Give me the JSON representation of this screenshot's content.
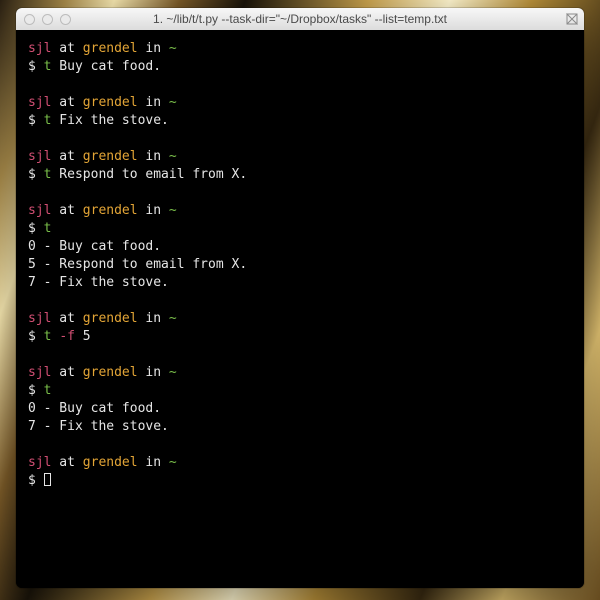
{
  "window": {
    "title": "1. ~/lib/t/t.py --task-dir=\"~/Dropbox/tasks\" --list=temp.txt"
  },
  "colors": {
    "user": "#d24f73",
    "host": "#e3a536",
    "path": "#7abf4a",
    "cmd": "#7abf4a",
    "flag": "#d24f73",
    "text": "#e6e6e6",
    "bg": "#000000"
  },
  "prompt": {
    "user": "sjl",
    "at": " at ",
    "host": "grendel",
    "in": " in ",
    "path": "~",
    "sigil": "$ "
  },
  "blocks": [
    {
      "cmdParts": [
        {
          "cls": "cmd",
          "t": "t"
        },
        {
          "cls": "arg",
          "t": " Buy cat food."
        }
      ],
      "output": []
    },
    {
      "cmdParts": [
        {
          "cls": "cmd",
          "t": "t"
        },
        {
          "cls": "arg",
          "t": " Fix the stove."
        }
      ],
      "output": []
    },
    {
      "cmdParts": [
        {
          "cls": "cmd",
          "t": "t"
        },
        {
          "cls": "arg",
          "t": " Respond to email from X."
        }
      ],
      "output": []
    },
    {
      "cmdParts": [
        {
          "cls": "cmd",
          "t": "t"
        }
      ],
      "output": [
        "0 - Buy cat food.",
        "5 - Respond to email from X.",
        "7 - Fix the stove."
      ]
    },
    {
      "cmdParts": [
        {
          "cls": "cmd",
          "t": "t "
        },
        {
          "cls": "flag",
          "t": "-f"
        },
        {
          "cls": "arg",
          "t": " 5"
        }
      ],
      "output": []
    },
    {
      "cmdParts": [
        {
          "cls": "cmd",
          "t": "t"
        }
      ],
      "output": [
        "0 - Buy cat food.",
        "7 - Fix the stove."
      ]
    },
    {
      "cmdParts": [],
      "output": [],
      "cursor": true
    }
  ]
}
